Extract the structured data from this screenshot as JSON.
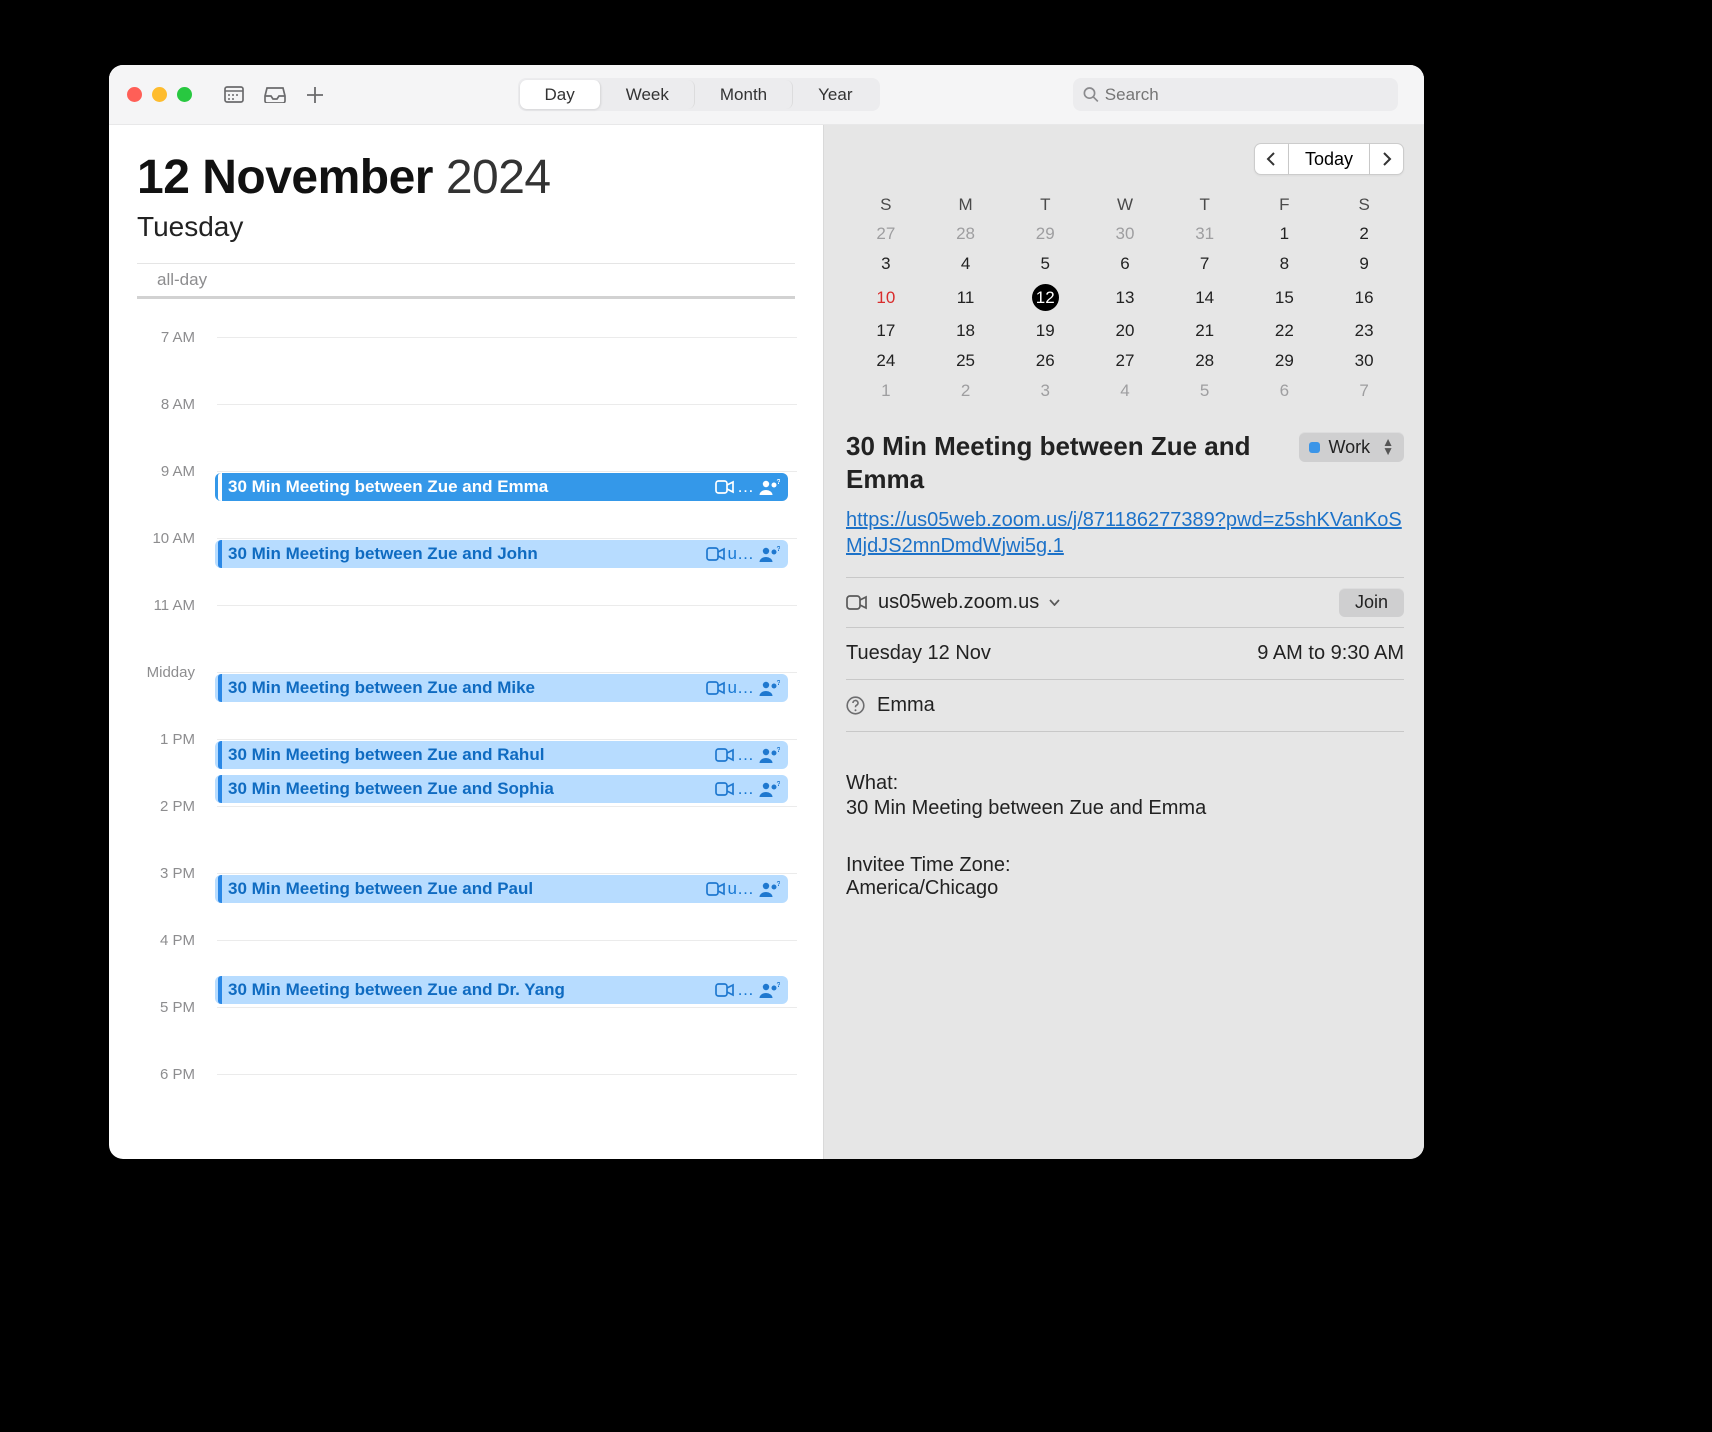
{
  "toolbar": {
    "views": [
      "Day",
      "Week",
      "Month",
      "Year"
    ],
    "active_view": "Day",
    "search_placeholder": "Search"
  },
  "header": {
    "day": "12",
    "month": "November",
    "year": "2024",
    "weekday": "Tuesday",
    "all_day_label": "all-day"
  },
  "hours": [
    "7 AM",
    "8 AM",
    "9 AM",
    "10 AM",
    "11 AM",
    "Midday",
    "1 PM",
    "2 PM",
    "3 PM",
    "4 PM",
    "5 PM",
    "6 PM"
  ],
  "events": [
    {
      "title": "30 Min Meeting between Zue and Emma",
      "time": "9:00",
      "selected": true,
      "location": "…"
    },
    {
      "title": "30 Min Meeting between Zue and John",
      "time": "10:00",
      "selected": false,
      "location": "u…"
    },
    {
      "title": "30 Min Meeting between Zue and Mike",
      "time": "12:00",
      "selected": false,
      "location": "u…"
    },
    {
      "title": "30 Min Meeting between Zue and Rahul",
      "time": "13:00",
      "selected": false,
      "location": "…"
    },
    {
      "title": "30 Min Meeting between Zue and Sophia",
      "time": "13:30",
      "selected": false,
      "location": "…"
    },
    {
      "title": "30 Min Meeting between Zue and Paul",
      "time": "15:00",
      "selected": false,
      "location": "u…"
    },
    {
      "title": "30 Min Meeting between Zue and Dr. Yang",
      "time": "16:30",
      "selected": false,
      "location": "…"
    }
  ],
  "nav": {
    "today": "Today"
  },
  "minicalendar": {
    "headers": [
      "S",
      "M",
      "T",
      "W",
      "T",
      "F",
      "S"
    ],
    "rows": [
      [
        {
          "d": "27",
          "style": "faded"
        },
        {
          "d": "28",
          "style": "faded"
        },
        {
          "d": "29",
          "style": "faded"
        },
        {
          "d": "30",
          "style": "faded"
        },
        {
          "d": "31",
          "style": "faded"
        },
        {
          "d": "1",
          "style": ""
        },
        {
          "d": "2",
          "style": ""
        }
      ],
      [
        {
          "d": "3",
          "style": ""
        },
        {
          "d": "4",
          "style": ""
        },
        {
          "d": "5",
          "style": ""
        },
        {
          "d": "6",
          "style": ""
        },
        {
          "d": "7",
          "style": ""
        },
        {
          "d": "8",
          "style": ""
        },
        {
          "d": "9",
          "style": ""
        }
      ],
      [
        {
          "d": "10",
          "style": "red"
        },
        {
          "d": "11",
          "style": ""
        },
        {
          "d": "12",
          "style": "selected"
        },
        {
          "d": "13",
          "style": ""
        },
        {
          "d": "14",
          "style": ""
        },
        {
          "d": "15",
          "style": ""
        },
        {
          "d": "16",
          "style": ""
        }
      ],
      [
        {
          "d": "17",
          "style": ""
        },
        {
          "d": "18",
          "style": ""
        },
        {
          "d": "19",
          "style": ""
        },
        {
          "d": "20",
          "style": ""
        },
        {
          "d": "21",
          "style": ""
        },
        {
          "d": "22",
          "style": ""
        },
        {
          "d": "23",
          "style": ""
        }
      ],
      [
        {
          "d": "24",
          "style": ""
        },
        {
          "d": "25",
          "style": ""
        },
        {
          "d": "26",
          "style": ""
        },
        {
          "d": "27",
          "style": ""
        },
        {
          "d": "28",
          "style": ""
        },
        {
          "d": "29",
          "style": ""
        },
        {
          "d": "30",
          "style": ""
        }
      ],
      [
        {
          "d": "1",
          "style": "faded"
        },
        {
          "d": "2",
          "style": "faded"
        },
        {
          "d": "3",
          "style": "faded"
        },
        {
          "d": "4",
          "style": "faded"
        },
        {
          "d": "5",
          "style": "faded"
        },
        {
          "d": "6",
          "style": "faded"
        },
        {
          "d": "7",
          "style": "faded"
        }
      ]
    ]
  },
  "inspector": {
    "title": "30 Min Meeting between Zue and Emma",
    "calendar": "Work",
    "link_text": "https://us05web.zoom.us/j/871186277389?pwd=z5shKVanKoSMjdJS2mnDmdWjwi5g.1",
    "location": "us05web.zoom.us",
    "join_label": "Join",
    "date_label": "Tuesday 12 Nov",
    "time_label": "9 AM to 9:30 AM",
    "attendee": "Emma",
    "desc_label": "What:",
    "desc_text": "30 Min Meeting between Zue and Emma",
    "tz_label": "Invitee Time Zone:",
    "tz_value": "America/Chicago"
  }
}
